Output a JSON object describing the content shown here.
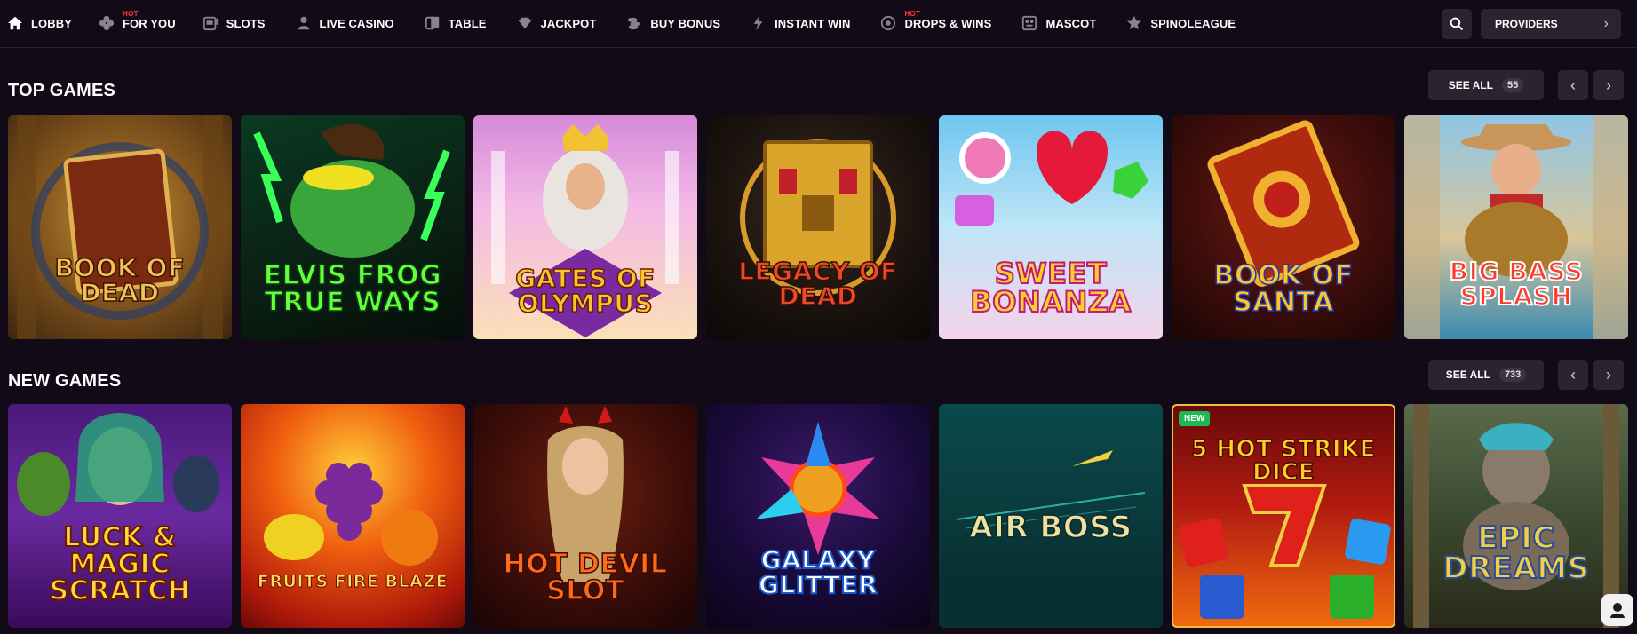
{
  "nav": {
    "items": [
      {
        "label": "LOBBY",
        "icon": "home-icon",
        "hot": ""
      },
      {
        "label": "FOR YOU",
        "icon": "clover-icon",
        "hot": "HOT"
      },
      {
        "label": "SLOTS",
        "icon": "slot-machine-icon",
        "hot": ""
      },
      {
        "label": "LIVE CASINO",
        "icon": "dealer-icon",
        "hot": ""
      },
      {
        "label": "TABLE",
        "icon": "cards-icon",
        "hot": ""
      },
      {
        "label": "JACKPOT",
        "icon": "diamond-icon",
        "hot": ""
      },
      {
        "label": "BUY BONUS",
        "icon": "coins-icon",
        "hot": ""
      },
      {
        "label": "INSTANT WIN",
        "icon": "lightning-icon",
        "hot": ""
      },
      {
        "label": "DROPS & WINS",
        "icon": "drops-icon",
        "hot": "HOT"
      },
      {
        "label": "MASCOT",
        "icon": "mascot-icon",
        "hot": ""
      },
      {
        "label": "SPINOLEAGUE",
        "icon": "star-icon",
        "hot": ""
      }
    ],
    "providers_label": "PROVIDERS"
  },
  "top_games": {
    "title": "TOP GAMES",
    "see_all_label": "SEE ALL",
    "count": "55",
    "games": [
      {
        "title": "BOOK OF DEAD"
      },
      {
        "title": "ELVIS FROG TRUE WAYS"
      },
      {
        "title": "GATES OF OLYMPUS"
      },
      {
        "title": "LEGACY OF DEAD"
      },
      {
        "title": "SWEET BONANZA"
      },
      {
        "title": "BOOK OF SANTA"
      },
      {
        "title": "BIG BASS SPLASH"
      }
    ]
  },
  "new_games": {
    "title": "NEW GAMES",
    "see_all_label": "SEE ALL",
    "count": "733",
    "games": [
      {
        "title": "LUCK & MAGIC SCRATCH",
        "badge": ""
      },
      {
        "title": "FRUITS FIRE BLAZE",
        "badge": ""
      },
      {
        "title": "HOT DEVIL SLOT",
        "badge": ""
      },
      {
        "title": "GALAXY GLITTER",
        "badge": ""
      },
      {
        "title": "AIR BOSS",
        "badge": ""
      },
      {
        "title": "5 HOT STRIKE DICE",
        "badge": "NEW"
      },
      {
        "title": "EPIC DREAMS",
        "badge": ""
      }
    ]
  },
  "colors": {
    "background": "#120a17",
    "button_bg": "#2a2430",
    "hot": "#ff3b3b",
    "new_badge": "#1db954"
  }
}
